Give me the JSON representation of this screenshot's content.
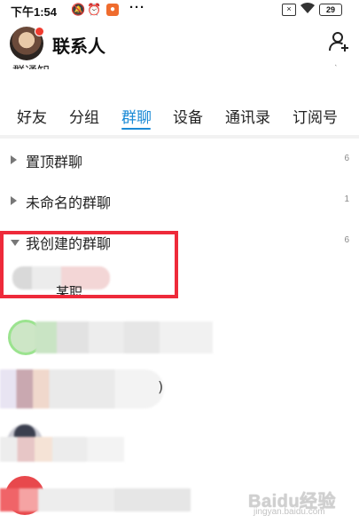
{
  "status_bar": {
    "time": "下午1:54",
    "dots": "···",
    "battery": "29"
  },
  "header": {
    "title": "联系人"
  },
  "tabs": [
    {
      "label": "好友",
      "active": false
    },
    {
      "label": "分组",
      "active": false
    },
    {
      "label": "群聊",
      "active": true
    },
    {
      "label": "设备",
      "active": false
    },
    {
      "label": "通讯录",
      "active": false
    },
    {
      "label": "订阅号",
      "active": false
    }
  ],
  "partial_row": {
    "label": "群通知"
  },
  "groups": [
    {
      "name": "置顶群聊",
      "count": "6",
      "expanded": false
    },
    {
      "name": "未命名的群聊",
      "count": "1",
      "expanded": false
    },
    {
      "name": "我创建的群聊",
      "count": "6",
      "expanded": true
    }
  ],
  "chat_items": [
    {
      "text": "某职"
    },
    {
      "text": ""
    },
    {
      "text": ")"
    },
    {
      "text": ""
    },
    {
      "text": ""
    }
  ],
  "watermark": {
    "logo": "Baidu经验",
    "url": "jingyan.baidu.com"
  },
  "colors": {
    "accent": "#1a8ad6",
    "highlight": "#ee2a3a",
    "avatar_badge": "#f03b2f"
  }
}
